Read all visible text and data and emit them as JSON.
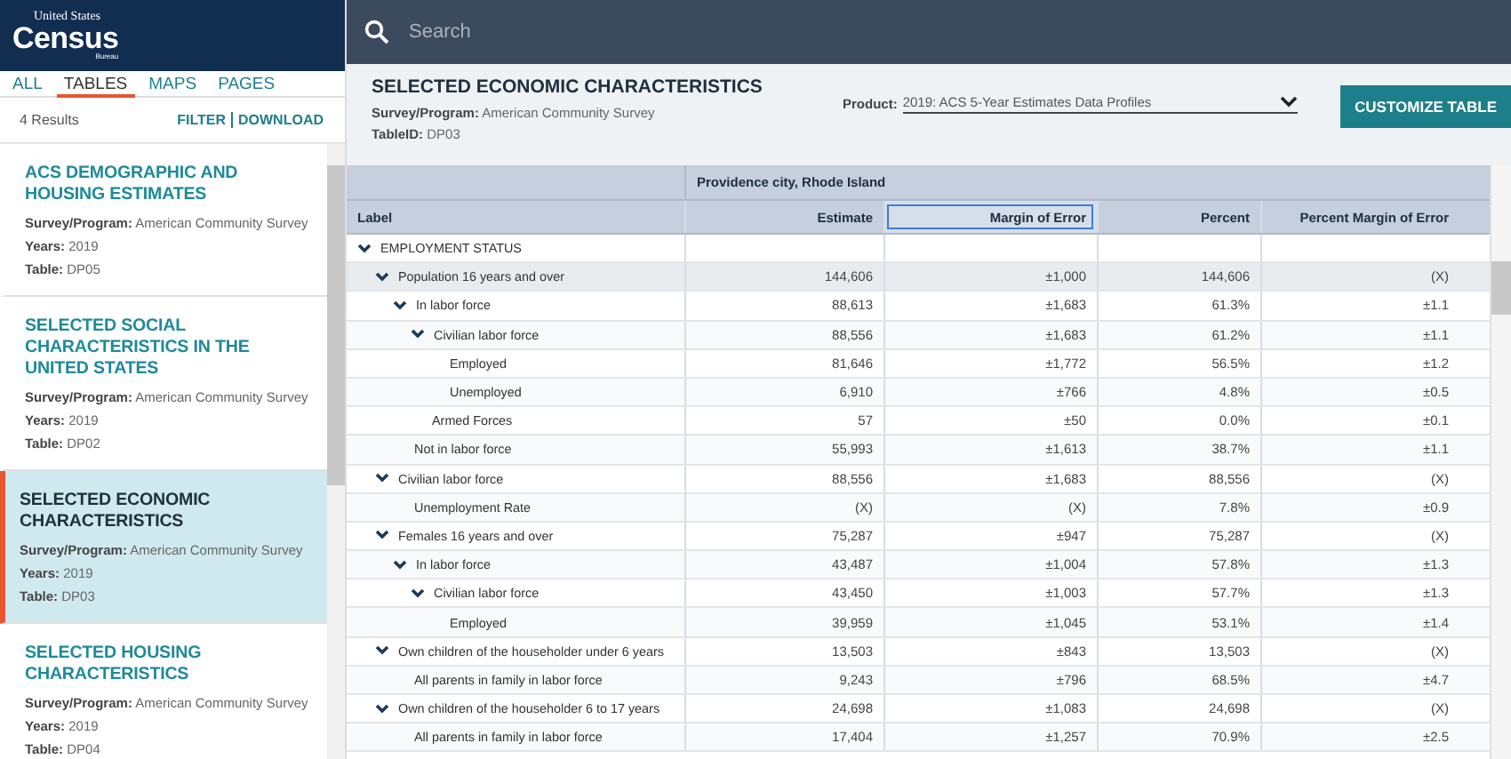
{
  "logo": {
    "top": "United States",
    "main": "Census",
    "sub": "Bureau"
  },
  "search": {
    "placeholder": "Search"
  },
  "tabs": [
    {
      "label": "ALL",
      "selected": false
    },
    {
      "label": "TABLES",
      "selected": true
    },
    {
      "label": "MAPS",
      "selected": false
    },
    {
      "label": "PAGES",
      "selected": false
    }
  ],
  "results": {
    "count": "4 Results",
    "actions": [
      "FILTER",
      "DOWNLOAD"
    ]
  },
  "result_items": [
    {
      "title": "ACS DEMOGRAPHIC AND HOUSING ESTIMATES",
      "fields": [
        {
          "label": "Survey/Program:",
          "value": "American Community Survey"
        },
        {
          "label": "Years:",
          "value": "2019"
        },
        {
          "label": "Table:",
          "value": "DP05"
        }
      ],
      "selected": false
    },
    {
      "title": "SELECTED SOCIAL CHARACTERISTICS IN THE UNITED STATES",
      "fields": [
        {
          "label": "Survey/Program:",
          "value": "American Community Survey"
        },
        {
          "label": "Years:",
          "value": "2019"
        },
        {
          "label": "Table:",
          "value": "DP02"
        }
      ],
      "selected": false
    },
    {
      "title": "SELECTED ECONOMIC CHARACTERISTICS",
      "fields": [
        {
          "label": "Survey/Program:",
          "value": "American Community Survey"
        },
        {
          "label": "Years:",
          "value": "2019"
        },
        {
          "label": "Table:",
          "value": "DP03"
        }
      ],
      "selected": true
    },
    {
      "title": "SELECTED HOUSING CHARACTERISTICS",
      "fields": [
        {
          "label": "Survey/Program:",
          "value": "American Community Survey"
        },
        {
          "label": "Years:",
          "value": "2019"
        },
        {
          "label": "Table:",
          "value": "DP04"
        }
      ],
      "selected": false
    }
  ],
  "table_header": {
    "title": "SELECTED ECONOMIC CHARACTERISTICS",
    "fields": [
      {
        "label": "Survey/Program:",
        "value": "American Community Survey"
      },
      {
        "label": "TableID:",
        "value": "DP03"
      }
    ],
    "product_label": "Product:",
    "product_value": "2019: ACS 5-Year Estimates Data Profiles",
    "button": "CUSTOMIZE TABLE"
  },
  "table": {
    "group": "Providence city, Rhode Island",
    "columns": [
      {
        "label": "Label",
        "selected": false
      },
      {
        "label": "Estimate",
        "selected": false
      },
      {
        "label": "Margin of Error",
        "selected": true
      },
      {
        "label": "Percent",
        "selected": false
      },
      {
        "label": "Percent Margin of Error",
        "selected": false
      }
    ],
    "rows": [
      {
        "label": "EMPLOYMENT STATUS",
        "values": [],
        "selected": false,
        "expanded": true,
        "children": [
          {
            "label": "Population 16 years and over",
            "values": [
              "144,606",
              "±1,000",
              "144,606",
              "(X)"
            ],
            "selected": true,
            "expanded": true,
            "children": [
              {
                "label": "In labor force",
                "values": [
                  "88,613",
                  "±1,683",
                  "61.3%",
                  "±1.1"
                ],
                "selected": false,
                "expanded": true,
                "children": [
                  {
                    "label": "Civilian labor force",
                    "values": [
                      "88,556",
                      "±1,683",
                      "61.2%",
                      "±1.1"
                    ],
                    "selected": false,
                    "expanded": true,
                    "children": [
                      {
                        "label": "Employed",
                        "values": [
                          "81,646",
                          "±1,772",
                          "56.5%",
                          "±1.2"
                        ],
                        "selected": false
                      },
                      {
                        "label": "Unemployed",
                        "values": [
                          "6,910",
                          "±766",
                          "4.8%",
                          "±0.5"
                        ],
                        "selected": false
                      }
                    ]
                  },
                  {
                    "label": "Armed Forces",
                    "values": [
                      "57",
                      "±50",
                      "0.0%",
                      "±0.1"
                    ],
                    "selected": false
                  }
                ]
              },
              {
                "label": "Not in labor force",
                "values": [
                  "55,993",
                  "±1,613",
                  "38.7%",
                  "±1.1"
                ],
                "selected": false
              }
            ]
          },
          {
            "label": "Civilian labor force",
            "values": [
              "88,556",
              "±1,683",
              "88,556",
              "(X)"
            ],
            "selected": false,
            "expanded": true,
            "children": [
              {
                "label": "Unemployment Rate",
                "values": [
                  "(X)",
                  "(X)",
                  "7.8%",
                  "±0.9"
                ],
                "selected": false
              }
            ]
          },
          {
            "label": "Females 16 years and over",
            "values": [
              "75,287",
              "±947",
              "75,287",
              "(X)"
            ],
            "selected": false,
            "expanded": true,
            "children": [
              {
                "label": "In labor force",
                "values": [
                  "43,487",
                  "±1,004",
                  "57.8%",
                  "±1.3"
                ],
                "selected": false,
                "expanded": true,
                "children": [
                  {
                    "label": "Civilian labor force",
                    "values": [
                      "43,450",
                      "±1,003",
                      "57.7%",
                      "±1.3"
                    ],
                    "selected": false,
                    "expanded": true,
                    "children": [
                      {
                        "label": "Employed",
                        "values": [
                          "39,959",
                          "±1,045",
                          "53.1%",
                          "±1.4"
                        ],
                        "selected": false
                      }
                    ]
                  }
                ]
              }
            ]
          },
          {
            "label": "Own children of the householder under 6 years",
            "values": [
              "13,503",
              "±843",
              "13,503",
              "(X)"
            ],
            "selected": false,
            "expanded": true,
            "children": [
              {
                "label": "All parents in family in labor force",
                "values": [
                  "9,243",
                  "±796",
                  "68.5%",
                  "±4.7"
                ],
                "selected": false
              }
            ]
          },
          {
            "label": "Own children of the householder 6 to 17 years",
            "values": [
              "24,698",
              "±1,083",
              "24,698",
              "(X)"
            ],
            "selected": false,
            "expanded": true,
            "children": [
              {
                "label": "All parents in family in labor force",
                "values": [
                  "17,404",
                  "±1,257",
                  "70.9%",
                  "±2.5"
                ],
                "selected": false
              }
            ]
          }
        ]
      }
    ]
  }
}
